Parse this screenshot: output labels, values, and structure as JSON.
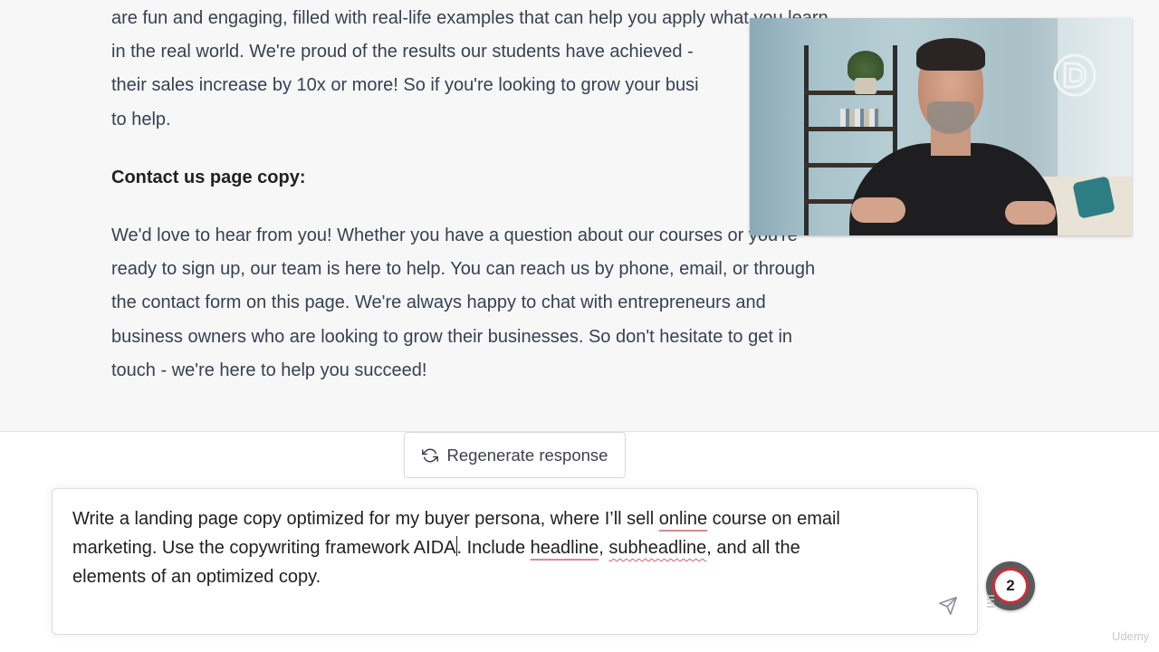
{
  "response": {
    "paragraph1_lines": [
      "are fun and engaging, filled with real-life examples that can help you apply what you learn",
      "in the real world. We're proud of the results our students have achieved -",
      "their sales increase by 10x or more! So if you're looking to grow your busi",
      "to help."
    ],
    "heading": "Contact us page copy:",
    "paragraph2_lines": [
      "We'd love to hear from you! Whether you have a question about our courses or you're",
      "ready to sign up, our team is here to help. You can reach us by phone, email, or through",
      "the contact form on this page. We're always happy to chat with entrepreneurs and",
      "business owners who are looking to grow their businesses. So don't hesitate to get in",
      "touch - we're here to help you succeed!"
    ]
  },
  "regenerate": {
    "icon": "refresh-icon",
    "label": "Regenerate response"
  },
  "prompt": {
    "line1_a": "Write a landing page copy optimized for my buyer persona, where I’ll sell ",
    "line1_misspelled": "online",
    "line1_b": " course on email",
    "line2_a": "marketing. Use the copywriting framework AIDA",
    "line2_b": ". Include ",
    "line2_word1": "headline",
    "line2_c": ", ",
    "line2_word2": "subheadline",
    "line2_d": ", and all the",
    "line3": "elements of an optimized copy.",
    "send_icon": "send-icon"
  },
  "badge": {
    "count": "2",
    "color": "#d12b3c"
  },
  "watermark": "Udemy"
}
